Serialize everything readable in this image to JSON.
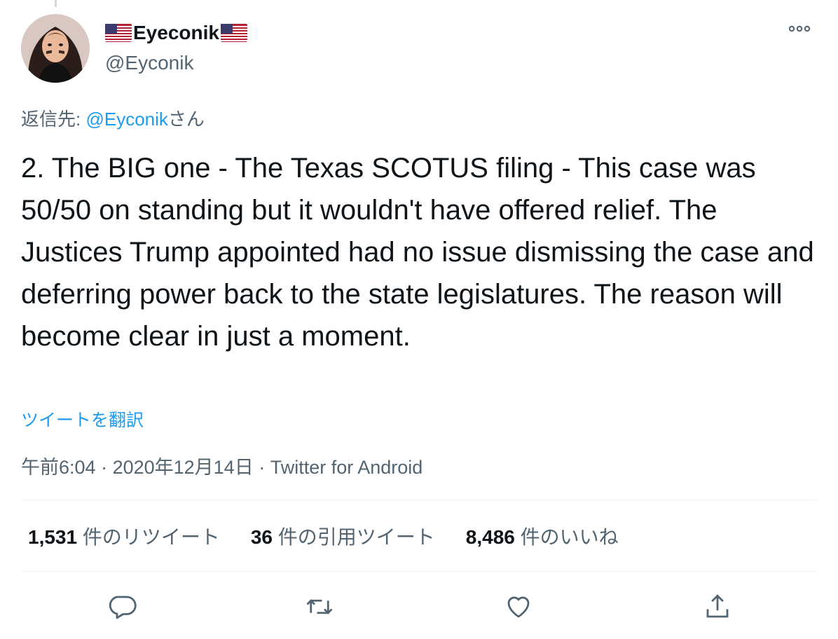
{
  "author": {
    "display_name": "Eyeconik",
    "handle": "@Eyconik",
    "flag_icon": "us-flag-icon"
  },
  "reply_to": {
    "prefix": "返信先: ",
    "mention": "@Eyconik",
    "suffix": "さん"
  },
  "tweet": {
    "text": "2. The BIG one - The Texas SCOTUS filing - This case was 50/50 on standing but it wouldn't have offered relief. The Justices Trump appointed had no issue dismissing the case and deferring power back to the state legislatures. The reason will become clear in just a moment.",
    "translate_label": "ツイートを翻訳",
    "time": "午前6:04",
    "date": "2020年12月14日",
    "separator": " · ",
    "source": "Twitter for Android"
  },
  "stats": {
    "retweets_count": "1,531",
    "retweets_label": " 件のリツイート",
    "quotes_count": "36",
    "quotes_label": " 件の引用ツイート",
    "likes_count": "8,486",
    "likes_label": " 件のいいね"
  },
  "colors": {
    "accent": "#1d9bf0",
    "secondary_text": "#536471",
    "primary_text": "#0f1419"
  },
  "icons": {
    "more": "more-horizontal-icon",
    "reply": "reply-bubble-icon",
    "retweet": "retweet-icon",
    "like": "heart-icon",
    "share": "share-icon"
  }
}
